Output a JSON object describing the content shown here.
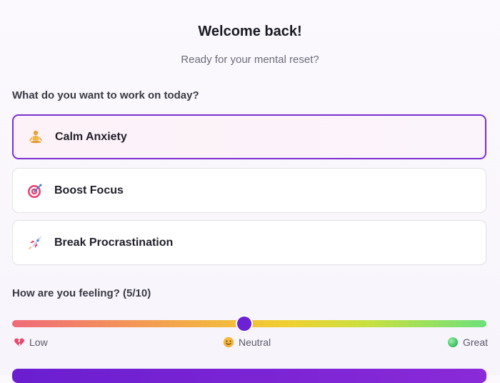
{
  "header": {
    "title": "Welcome back!",
    "subtitle": "Ready for your mental reset?"
  },
  "focus": {
    "question": "What do you want to work on today?",
    "options": [
      {
        "label": "Calm Anxiety",
        "icon": "meditation-icon",
        "selected": true
      },
      {
        "label": "Boost Focus",
        "icon": "target-icon",
        "selected": false
      },
      {
        "label": "Break Procrastination",
        "icon": "rocket-icon",
        "selected": false
      }
    ]
  },
  "mood": {
    "label": "How are you feeling? (5/10)",
    "value": 5,
    "min": 0,
    "max": 10,
    "scale": {
      "low": "Low",
      "neutral": "Neutral",
      "great": "Great"
    }
  },
  "colors": {
    "accent": "#7a2ed0",
    "thumb": "#6a22d4"
  }
}
